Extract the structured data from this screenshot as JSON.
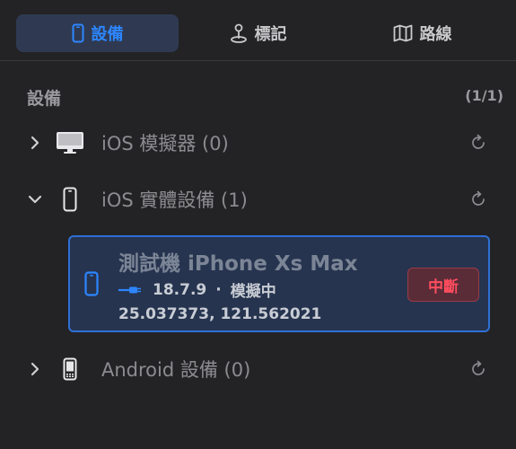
{
  "tabs": [
    {
      "label": "設備",
      "icon": "phone-icon",
      "active": true
    },
    {
      "label": "標記",
      "icon": "pin-icon",
      "active": false
    },
    {
      "label": "路線",
      "icon": "map-icon",
      "active": false
    }
  ],
  "section": {
    "title": "設備",
    "count": "(1/1)"
  },
  "groups": {
    "ios_simulator": {
      "label": "iOS 模擬器 (0)",
      "expanded": false,
      "icon": "desktop-icon"
    },
    "ios_real": {
      "label": "iOS 實體設備 (1)",
      "expanded": true,
      "icon": "phone-outline-icon"
    },
    "android": {
      "label": "Android 設備 (0)",
      "expanded": false,
      "icon": "android-phone-icon"
    }
  },
  "device": {
    "name": "測試機 iPhone Xs Max",
    "version": "18.7.9",
    "separator": "·",
    "status": "模擬中",
    "coords": "25.037373, 121.562021",
    "action_label": "中斷"
  },
  "colors": {
    "accent": "#2d86ff",
    "background": "#232325",
    "danger": "#ff4d5e"
  }
}
